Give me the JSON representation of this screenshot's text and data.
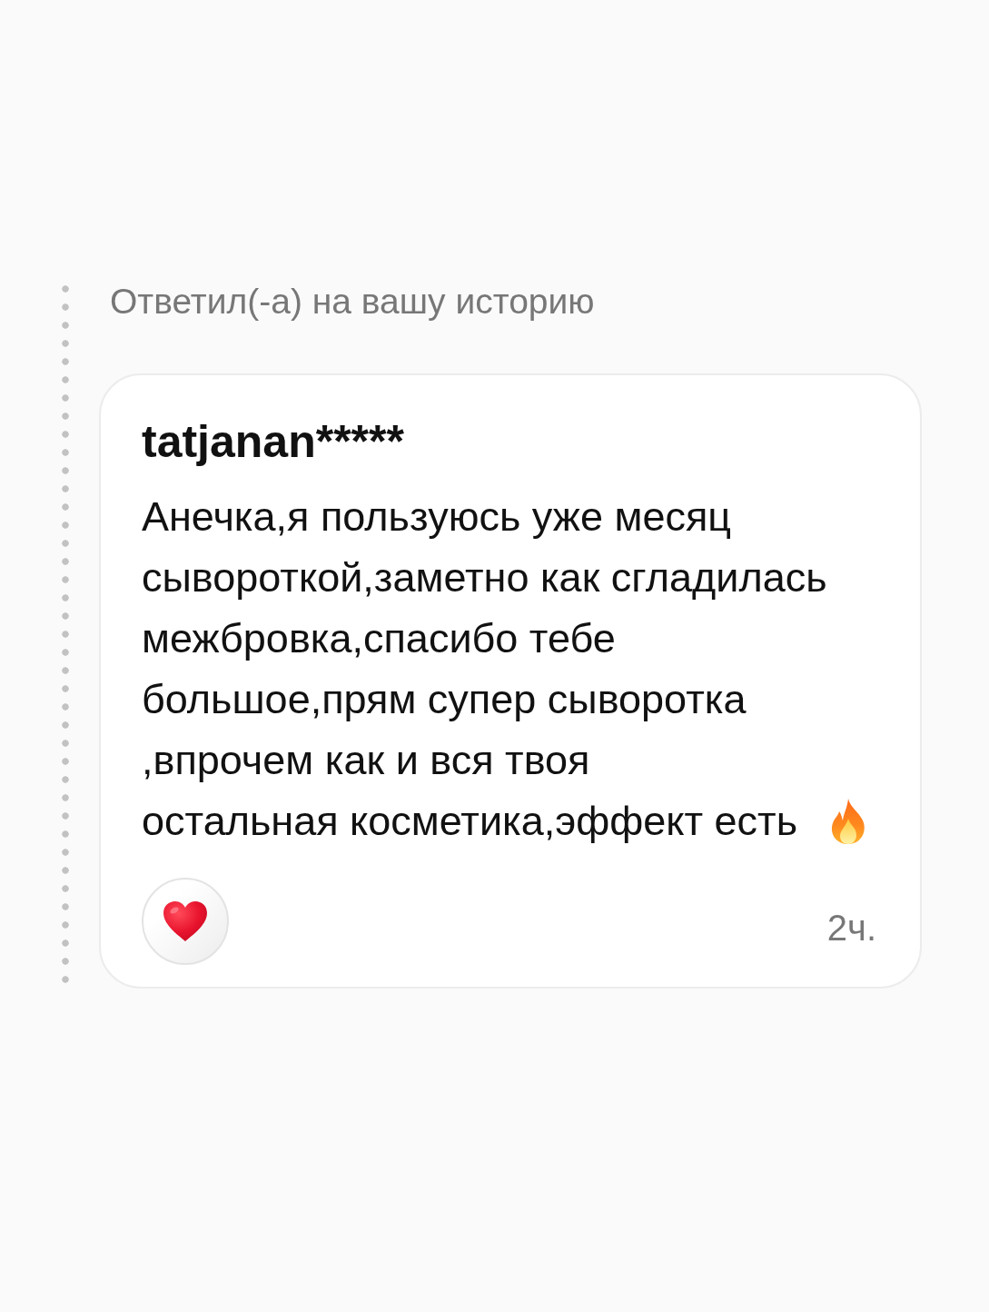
{
  "story_reply": {
    "label": "Ответил(-а) на вашу историю"
  },
  "message": {
    "author": "tatjanan*****",
    "text": "Анечка,я пользуюсь уже месяц\nсывороткой,заметно как сгладилась\nмежбровка,спасибо тебе\nбольшое,прям супер сыворотка\n,впрочем как и вся твоя\nостальная косметика,эффект есть",
    "time": "2ч."
  }
}
